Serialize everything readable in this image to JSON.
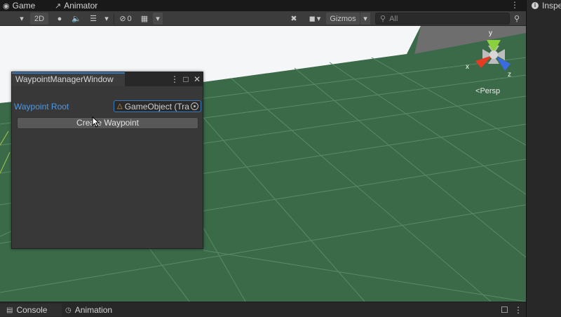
{
  "top_tabs": [
    {
      "label": "Game",
      "icon": "gamepad-icon"
    },
    {
      "label": "Animator",
      "icon": "animator-icon"
    }
  ],
  "inspector_tab": {
    "label": "Inspe",
    "icon": "info-icon"
  },
  "toolbar": {
    "mode_2d": "2D",
    "hidden_count": "0",
    "gizmos_label": "Gizmos",
    "search_placeholder": "All"
  },
  "scene": {
    "projection_label": "Persp",
    "gizmo_axes": {
      "x": "x",
      "y": "y",
      "z": "z"
    },
    "colors": {
      "ground": "#3a6a48",
      "sky": "#f4f6f8",
      "grid_line": "#5a8a66",
      "x_axis": "#e53a24",
      "y_axis": "#8bd13b",
      "z_axis": "#3a6ce0"
    }
  },
  "waypoint_window": {
    "title": "WaypointManagerWindow",
    "field_label": "Waypoint Root",
    "field_value": "GameObject (Tra",
    "create_button": "Create Waypoint"
  },
  "bottom_tabs": [
    {
      "label": "Console",
      "icon": "console-icon"
    },
    {
      "label": "Animation",
      "icon": "animation-icon"
    }
  ]
}
